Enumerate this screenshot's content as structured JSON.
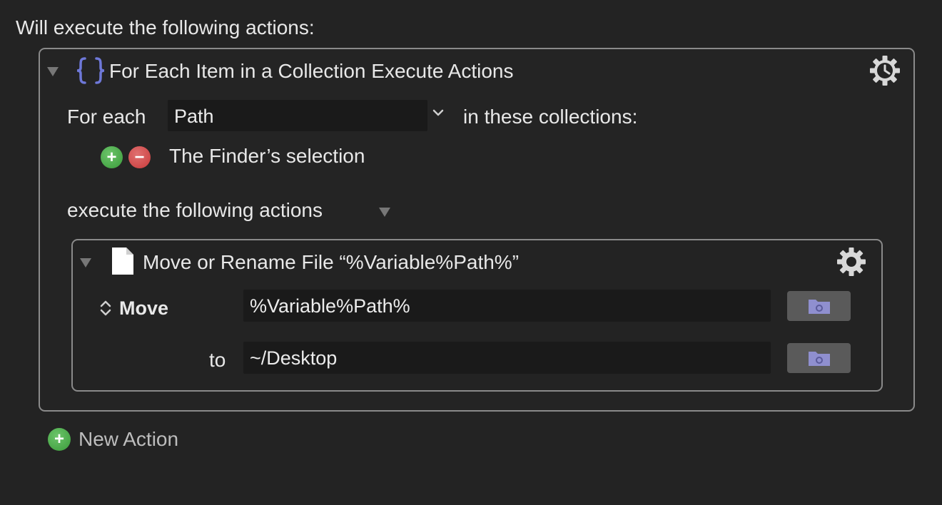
{
  "header": {
    "title": "Will execute the following actions:"
  },
  "outer_action": {
    "title": "For Each Item in a Collection Execute Actions",
    "icon": "curly-braces-icon",
    "for_each_label": "For each",
    "variable_value": "Path",
    "in_collections_label": "in these collections:",
    "collection_item": "The Finder’s selection",
    "execute_label": "execute the following actions"
  },
  "inner_action": {
    "title": "Move or Rename File “%Variable%Path%”",
    "icon": "document-icon",
    "operation_value": "Move",
    "source_value": "%Variable%Path%",
    "to_label": "to",
    "destination_value": "~/Desktop"
  },
  "footer": {
    "new_action_label": "New Action"
  },
  "colors": {
    "background": "#232323",
    "border": "#8a8a8a",
    "field": "#1a1a1a",
    "brace_accent": "#6e78d8",
    "add_green": "#4aa84a",
    "remove_red": "#d04545"
  }
}
